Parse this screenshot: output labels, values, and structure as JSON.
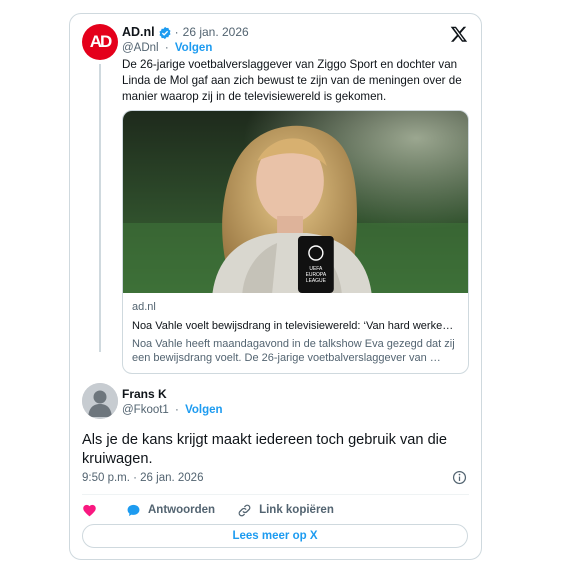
{
  "parent_tweet": {
    "avatar_text": "AD",
    "author_name": "AD.nl",
    "separator": "·",
    "date": "26 jan. 2026",
    "handle": "@ADnl",
    "follow_label": "Volgen",
    "text": "De 26-jarige voetbalverslaggever van Ziggo Sport en dochter van Linda de Mol gaf aan zich bewust te zijn van de meningen over de manier waarop zij in de televisiewereld is gekomen.",
    "brand_color": "#e4001b",
    "link_card": {
      "domain": "ad.nl",
      "title": "Noa Vahle voelt bewijsdrang in televisiewereld: ‘Van hard werke…",
      "description": "Noa Vahle heeft maandagavond in de talkshow Eva gezegd dat zij een bewijsdrang voelt. De 26-jarige voetbalverslaggever van …",
      "mic_label_line1": "UEFA",
      "mic_label_line2": "EUROPA",
      "mic_label_line3": "LEAGUE"
    }
  },
  "tweet": {
    "author_name": "Frans K",
    "handle": "@Fkoot1",
    "separator": "·",
    "follow_label": "Volgen",
    "text": "Als je de kans krijgt maakt iedereen toch gebruik van die kruiwagen.",
    "timestamp": "9:50 p.m. · 26 jan. 2026"
  },
  "actions": {
    "like_icon": "heart-icon",
    "reply_label": "Antwoorden",
    "reply_icon": "speech-bubble-icon",
    "copy_link_label": "Link kopiëren",
    "copy_link_icon": "link-icon"
  },
  "more_button_label": "Lees meer op X",
  "colors": {
    "accent": "#1d9bf0",
    "like": "#f91880",
    "text": "#0f1419",
    "muted": "#536471",
    "border": "#cfd9de"
  }
}
